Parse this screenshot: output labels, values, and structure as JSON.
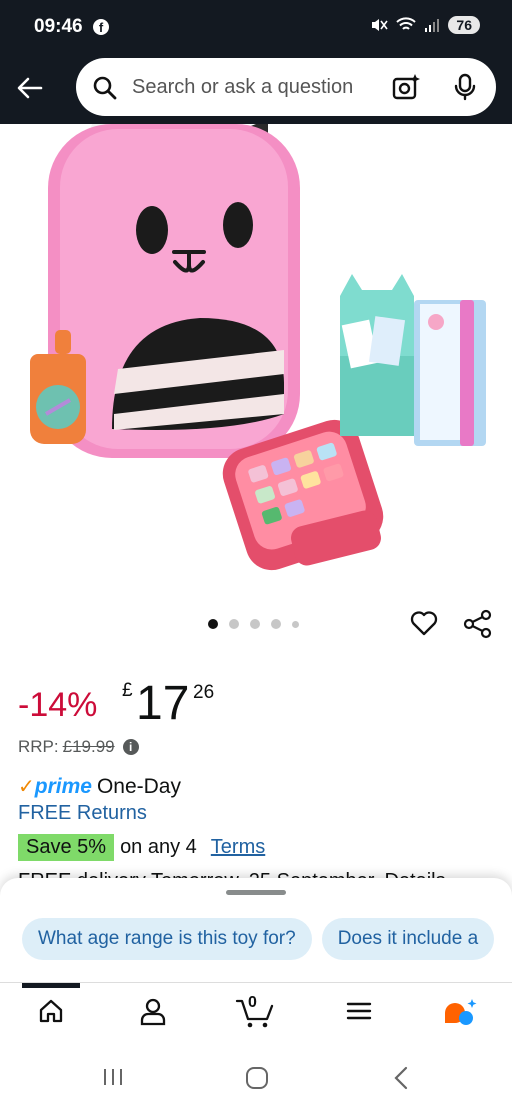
{
  "status_bar": {
    "time": "09:46",
    "battery": "76"
  },
  "search": {
    "placeholder": "Search or ask a question"
  },
  "carousel": {
    "total": 5,
    "active": 1
  },
  "price": {
    "discount": "-14%",
    "currency": "£",
    "whole": "17",
    "fraction": "26",
    "rrp_label": "RRP:",
    "rrp_value": "£19.99"
  },
  "delivery": {
    "prime_check": "✓",
    "prime_word": "prime",
    "prime_speed": "One-Day",
    "free_returns": "FREE Returns"
  },
  "promo": {
    "badge": "Save 5%",
    "text": "on any 4",
    "terms": "Terms"
  },
  "partial_text": "FREE delivery Tomorrow, 25 September. Details",
  "suggestions": [
    "What age range is this toy for?",
    "Does it include a"
  ],
  "bottom_nav": {
    "cart_count": "0"
  },
  "colors": {
    "header": "#131921",
    "discount": "#cc0c39",
    "link": "#2162a1",
    "save_badge": "#7fda69",
    "prime": "#1a98ff"
  }
}
